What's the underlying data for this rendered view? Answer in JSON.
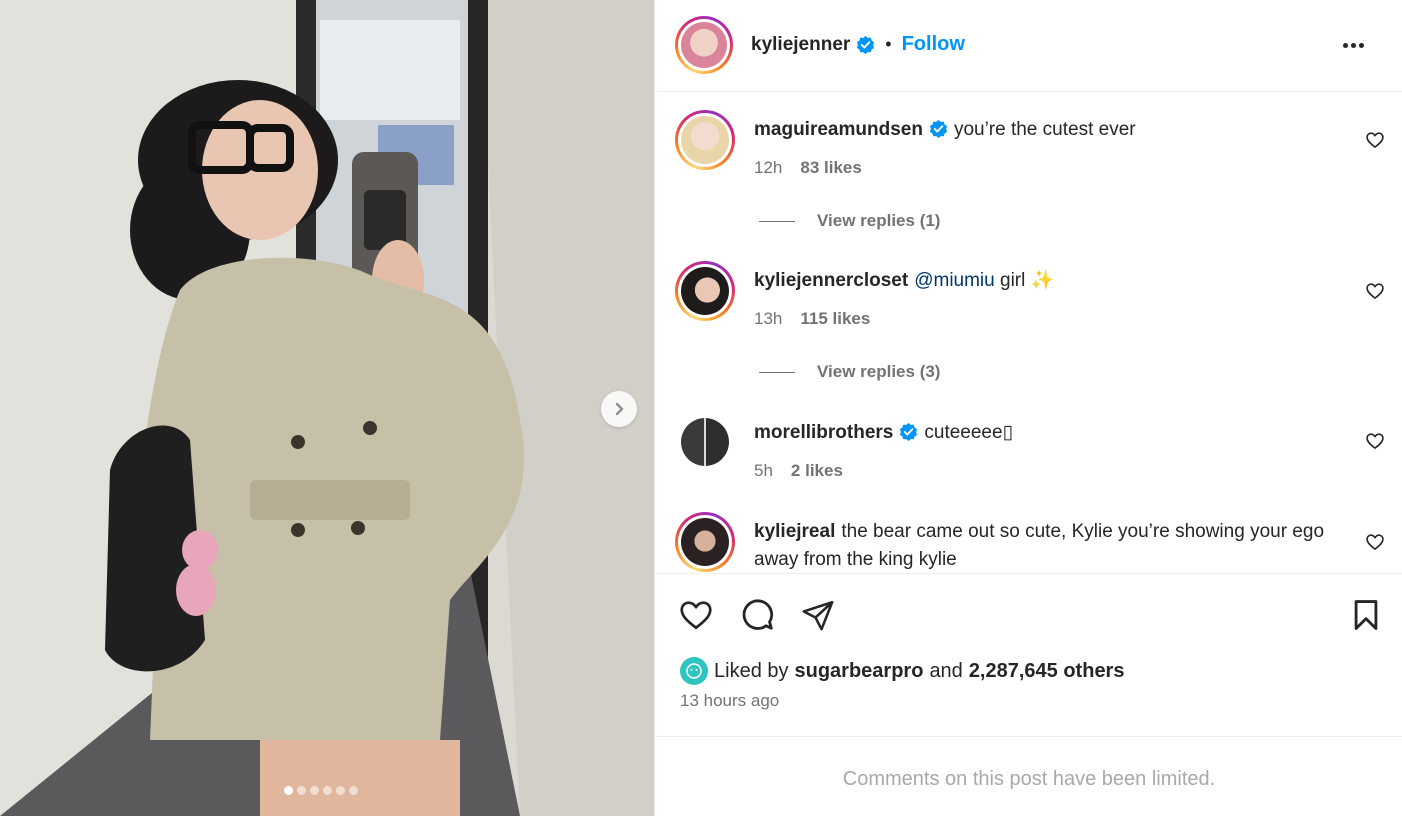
{
  "post": {
    "author": "kyliejenner",
    "separator": "•",
    "follow_label": "Follow",
    "carousel_count": 6,
    "carousel_active_index": 0
  },
  "comments": [
    {
      "username": "maguireamundsen",
      "verified": true,
      "text": "you’re the cutest ever",
      "time": "12h",
      "likes": "83 likes",
      "replies": "View replies (1)"
    },
    {
      "username": "kyliejennercloset",
      "verified": false,
      "mention": "@miumiu",
      "text": "girl ✨",
      "time": "13h",
      "likes": "115 likes",
      "replies": "View replies (3)"
    },
    {
      "username": "morellibrothers",
      "verified": true,
      "text": "cuteeeee▯",
      "time": "5h",
      "likes": "2 likes"
    },
    {
      "username": "kyliejreal",
      "verified": false,
      "text": "the bear came out so cute, Kylie you’re showing your ego away from the king kylie"
    }
  ],
  "liked_by": {
    "prefix": "Liked by",
    "user": "sugarbearpro",
    "conj": "and",
    "others": "2,287,645 others"
  },
  "time_ago": "13 hours ago",
  "comments_limited": "Comments on this post have been limited.",
  "colors": {
    "accent": "#0095f6",
    "verified": "#0095f6",
    "text": "#262626",
    "muted": "#737373",
    "disabled": "#a8a8a8"
  }
}
